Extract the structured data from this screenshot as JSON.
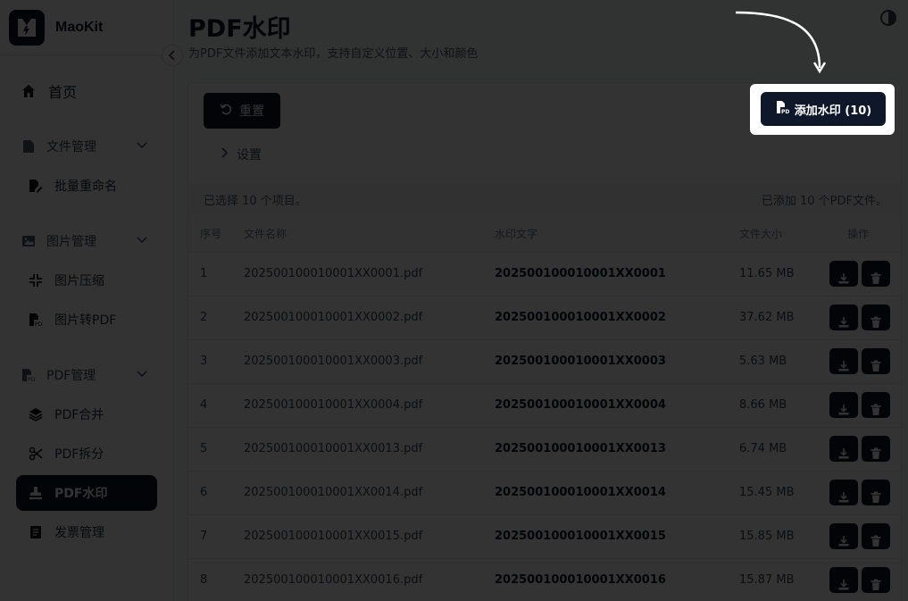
{
  "app": {
    "name": "MaoKit"
  },
  "sidebar": {
    "home": "首页",
    "groups": [
      {
        "label": "文件管理",
        "items": [
          {
            "label": "批量重命名",
            "icon": "file-edit-icon"
          }
        ]
      },
      {
        "label": "图片管理",
        "items": [
          {
            "label": "图片压缩",
            "icon": "compress-icon"
          },
          {
            "label": "图片转PDF",
            "icon": "pdf-file-icon"
          }
        ]
      },
      {
        "label": "PDF管理",
        "items": [
          {
            "label": "PDF合并",
            "icon": "layers-icon"
          },
          {
            "label": "PDF拆分",
            "icon": "scissors-icon"
          },
          {
            "label": "PDF水印",
            "icon": "stamp-icon"
          },
          {
            "label": "发票管理",
            "icon": "invoice-icon"
          }
        ]
      }
    ]
  },
  "header": {
    "title": "PDF水印",
    "subtitle": "为PDF文件添加文本水印，支持自定义位置、大小和颜色"
  },
  "toolbar": {
    "reset_label": "重置",
    "settings_label": "设置",
    "add_label": "添加水印 (10)"
  },
  "status": {
    "selected": "已选择 10 个项目。",
    "added": "已添加 10 个PDF文件。"
  },
  "table": {
    "headers": {
      "idx": "序号",
      "name": "文件名称",
      "watermark": "水印文字",
      "size": "文件大小",
      "ops": "操作"
    },
    "rows": [
      {
        "idx": "1",
        "name": "202500100010001XX0001.pdf",
        "watermark": "202500100010001XX0001",
        "size": "11.65 MB"
      },
      {
        "idx": "2",
        "name": "202500100010001XX0002.pdf",
        "watermark": "202500100010001XX0002",
        "size": "37.62 MB"
      },
      {
        "idx": "3",
        "name": "202500100010001XX0003.pdf",
        "watermark": "202500100010001XX0003",
        "size": "5.63 MB"
      },
      {
        "idx": "4",
        "name": "202500100010001XX0004.pdf",
        "watermark": "202500100010001XX0004",
        "size": "8.66 MB"
      },
      {
        "idx": "5",
        "name": "202500100010001XX0013.pdf",
        "watermark": "202500100010001XX0013",
        "size": "6.74 MB"
      },
      {
        "idx": "6",
        "name": "202500100010001XX0014.pdf",
        "watermark": "202500100010001XX0014",
        "size": "15.45 MB"
      },
      {
        "idx": "7",
        "name": "202500100010001XX0015.pdf",
        "watermark": "202500100010001XX0015",
        "size": "15.85 MB"
      },
      {
        "idx": "8",
        "name": "202500100010001XX0016.pdf",
        "watermark": "202500100010001XX0016",
        "size": "15.87 MB"
      }
    ]
  },
  "colors": {
    "primary": "#0f172a",
    "overlay": "rgba(0,0,0,0.8)"
  }
}
